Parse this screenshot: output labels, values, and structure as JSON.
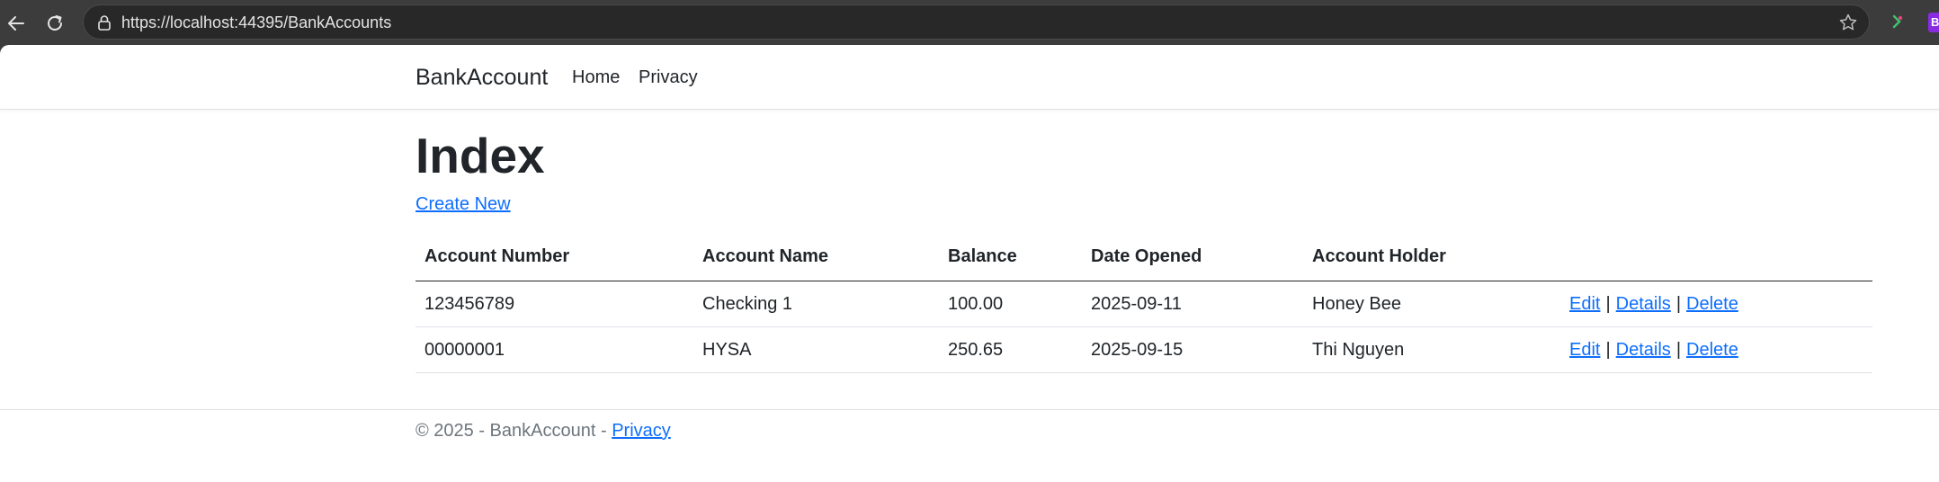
{
  "browser": {
    "url": "https://localhost:44395/BankAccounts",
    "back_icon": "back-arrow-icon",
    "reload_icon": "reload-icon",
    "lock_icon": "lock-icon",
    "star_icon": "star-icon",
    "extension_badge": "B"
  },
  "navbar": {
    "brand": "BankAccount",
    "links": [
      "Home",
      "Privacy"
    ]
  },
  "main": {
    "title": "Index",
    "create_link": "Create New",
    "table": {
      "columns": [
        "Account Number",
        "Account Name",
        "Balance",
        "Date Opened",
        "Account Holder"
      ],
      "rows": [
        {
          "account_number": "123456789",
          "account_name": "Checking 1",
          "balance": "100.00",
          "date_opened": "2025-09-11",
          "account_holder": "Honey Bee",
          "actions": [
            "Edit",
            "Details",
            "Delete"
          ],
          "separator": "|"
        },
        {
          "account_number": "00000001",
          "account_name": "HYSA",
          "balance": "250.65",
          "date_opened": "2025-09-15",
          "account_holder": "Thi Nguyen",
          "actions": [
            "Edit",
            "Details",
            "Delete"
          ],
          "separator": "|"
        }
      ]
    }
  },
  "footer": {
    "text": "© 2025 - BankAccount - ",
    "privacy_link": "Privacy"
  },
  "colors": {
    "link": "#0d6efd",
    "text": "#212529",
    "muted": "#6c757d",
    "border": "#dee2e6"
  }
}
